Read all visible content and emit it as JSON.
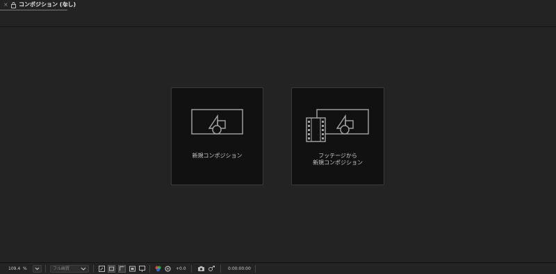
{
  "panel": {
    "close_glyph": "×",
    "title": "コンポジション (なし)",
    "menu_glyph": "≡"
  },
  "cards": {
    "new_comp": {
      "label": "新規コンポジション"
    },
    "from_footage": {
      "label_line1": "フッテージから",
      "label_line2": "新規コンポジション"
    }
  },
  "toolbar": {
    "zoom_value": "109.4",
    "zoom_unit": "%",
    "resolution": "フル画質",
    "exposure": "+0.0",
    "timecode": "0:00:00:00"
  },
  "icons": {
    "close": "close-icon",
    "lock": "lock-icon",
    "menu": "hamburger-menu-icon",
    "composition": "composition-icon",
    "film": "film-strip-icon",
    "chevron": "chevron-down-icon",
    "camera": "camera-icon"
  },
  "colors": {
    "background": "#232323",
    "card": "#111111",
    "card_border": "#3a3a3a",
    "text": "#cfcfcf"
  }
}
